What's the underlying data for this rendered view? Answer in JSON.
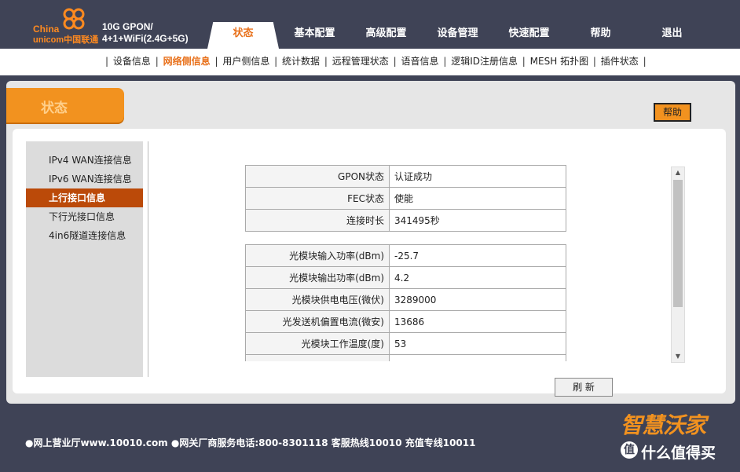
{
  "header": {
    "logo_line1": "China",
    "logo_line2": "unicom中国联通",
    "model_line1": "10G GPON/",
    "model_line2": "4+1+WiFi(2.4G+5G)",
    "tabs": [
      {
        "label": "状态",
        "active": true
      },
      {
        "label": "基本配置"
      },
      {
        "label": "高级配置"
      },
      {
        "label": "设备管理"
      },
      {
        "label": "快速配置"
      },
      {
        "label": "帮助"
      },
      {
        "label": "退出"
      }
    ]
  },
  "subnav": {
    "items": [
      {
        "label": "设备信息"
      },
      {
        "label": "网络侧信息",
        "active": true
      },
      {
        "label": "用户侧信息"
      },
      {
        "label": "统计数据"
      },
      {
        "label": "远程管理状态"
      },
      {
        "label": "语音信息"
      },
      {
        "label": "逻辑ID注册信息"
      },
      {
        "label": "MESH 拓扑图"
      },
      {
        "label": "插件状态"
      }
    ]
  },
  "panel": {
    "status_label": "状态",
    "help_label": "帮助",
    "refresh_label": "刷 新"
  },
  "leftnav": {
    "items": [
      {
        "label": "IPv4 WAN连接信息"
      },
      {
        "label": "IPv6 WAN连接信息"
      },
      {
        "label": "上行接口信息",
        "active": true
      },
      {
        "label": "下行光接口信息"
      },
      {
        "label": "4in6隧道连接信息"
      }
    ]
  },
  "gpon_table": [
    {
      "key": "GPON状态",
      "value": "认证成功"
    },
    {
      "key": "FEC状态",
      "value": "使能"
    },
    {
      "key": "连接时长",
      "value": "341495秒"
    }
  ],
  "optical_table": [
    {
      "key": "光模块输入功率(dBm)",
      "value": "-25.7"
    },
    {
      "key": "光模块输出功率(dBm)",
      "value": "4.2"
    },
    {
      "key": "光模块供电电压(微伏)",
      "value": "3289000"
    },
    {
      "key": "光发送机偏置电流(微安)",
      "value": "13686"
    },
    {
      "key": "光模块工作温度(度)",
      "value": "53"
    }
  ],
  "footer": {
    "text": "●网上营业厅www.10010.com ●网关厂商服务电话:800-8301118 客服热线10010 充值专线10011"
  },
  "watermark": {
    "brand": "智慧沃家",
    "site": "什么值得买",
    "site_mark": "值"
  },
  "colors": {
    "header_bg": "#3f4356",
    "accent": "#f2921f",
    "active_text": "#e8701a",
    "nav_active_bg": "#bb4a09"
  }
}
